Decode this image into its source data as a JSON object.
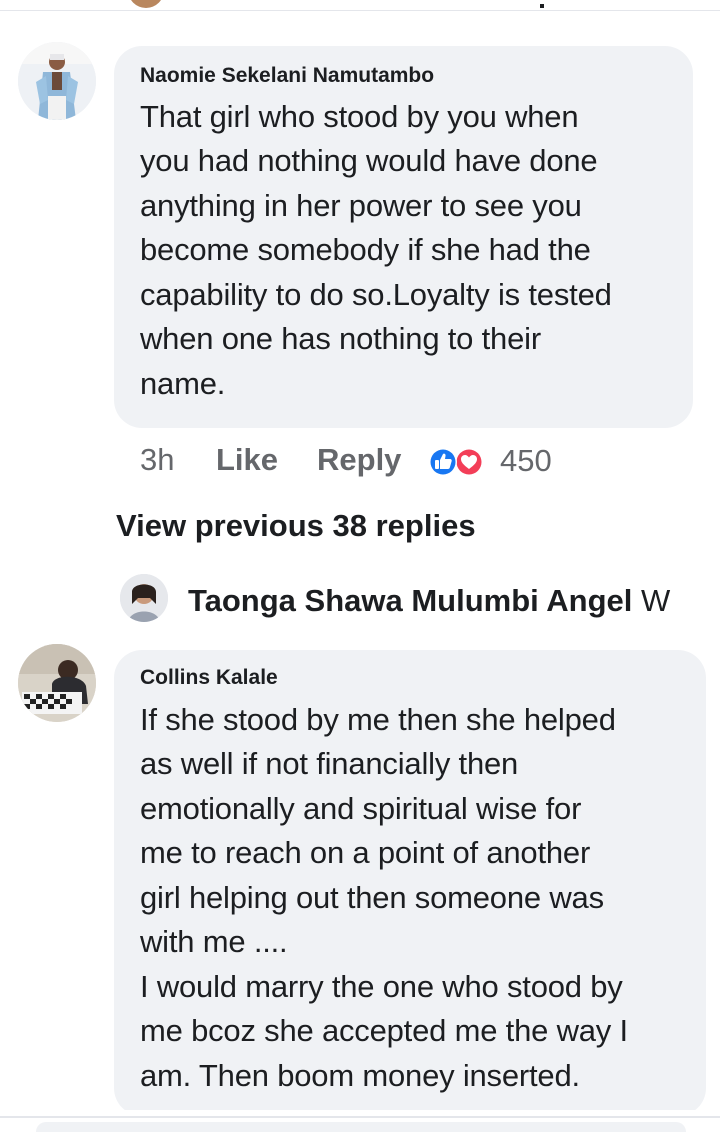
{
  "comment1": {
    "author": "Naomie Sekelani Namutambo",
    "lines": [
      "That girl who stood by you when",
      "you had nothing would have done",
      "anything in her power to see you",
      "become somebody if she had the",
      "capability to do so.Loyalty is tested",
      "when one has nothing to their",
      "name."
    ],
    "time": "3h",
    "like_label": "Like",
    "reply_label": "Reply",
    "reaction_icons": [
      "like-icon",
      "love-icon"
    ],
    "reaction_count": "450"
  },
  "view_previous": "View previous 38 replies",
  "reply_preview": {
    "author": "Taonga Shawa Mulumbi Angel",
    "snippet": "W"
  },
  "comment2": {
    "author": "Collins Kalale",
    "lines": [
      "If she stood by me  then she helped",
      "as well if not financially then",
      "emotionally and spiritual wise for",
      "me to reach on a point of another",
      "girl helping out then someone was",
      "with me ....",
      "I would marry the one who stood by",
      "me bcoz she accepted me the way I",
      "am. Then boom money inserted."
    ]
  },
  "colors": {
    "bubble": "#f0f2f5",
    "text": "#1c1e21",
    "meta": "#65676b",
    "like_blue": "#1877f2",
    "love_red": "#f33e58"
  }
}
